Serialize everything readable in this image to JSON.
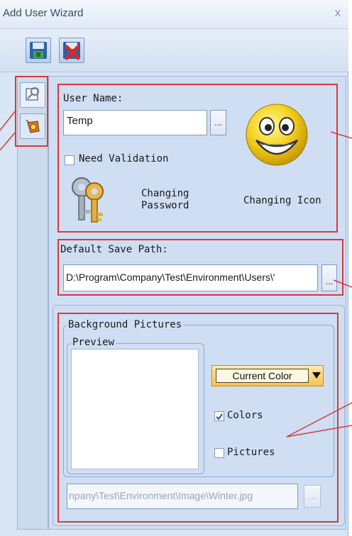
{
  "window": {
    "title": "Add User Wizard",
    "close_glyph": "x"
  },
  "toolbar": {
    "buttons": [
      {
        "name": "save-icon"
      },
      {
        "name": "cancel-icon"
      }
    ]
  },
  "sidebar": {
    "items": [
      {
        "name": "user-settings-icon"
      },
      {
        "name": "background-pictures-icon"
      }
    ]
  },
  "user": {
    "name_label": "User Name:",
    "name_value": "Temp",
    "browse_label": "...",
    "need_validation_label": "Need Validation",
    "need_validation_checked": false,
    "changing_password_label": "Changing\nPassword",
    "changing_icon_label": "Changing Icon"
  },
  "save_path": {
    "label": "Default Save Path:",
    "value": "D:\\Program\\Company\\Test\\Environment\\Users\\'",
    "browse_label": "..."
  },
  "background": {
    "group_label": "Background Pictures",
    "preview_label": "Preview",
    "color_dropdown_value": "Current Color",
    "colors_label": "Colors",
    "colors_checked": true,
    "pictures_label": "Pictures",
    "pictures_checked": false,
    "image_path": "npany\\Test\\Environment\\Image\\Winter.jpg",
    "browse_label": "..."
  },
  "colors": {
    "callout": "#d63a3a",
    "accent": "#f5c842"
  }
}
